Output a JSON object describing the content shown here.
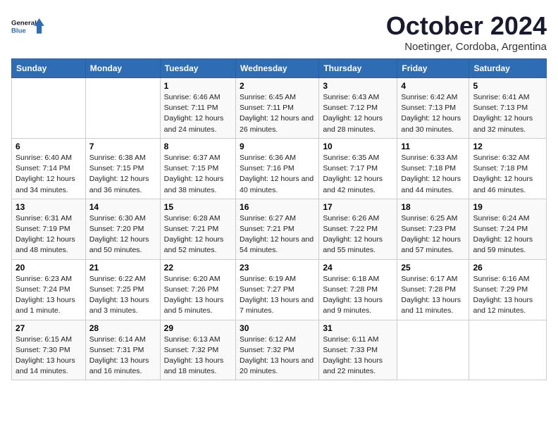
{
  "logo": {
    "line1": "General",
    "line2": "Blue"
  },
  "title": "October 2024",
  "subtitle": "Noetinger, Cordoba, Argentina",
  "days_header": [
    "Sunday",
    "Monday",
    "Tuesday",
    "Wednesday",
    "Thursday",
    "Friday",
    "Saturday"
  ],
  "weeks": [
    [
      {
        "num": "",
        "detail": ""
      },
      {
        "num": "",
        "detail": ""
      },
      {
        "num": "1",
        "detail": "Sunrise: 6:46 AM\nSunset: 7:11 PM\nDaylight: 12 hours and 24 minutes."
      },
      {
        "num": "2",
        "detail": "Sunrise: 6:45 AM\nSunset: 7:11 PM\nDaylight: 12 hours and 26 minutes."
      },
      {
        "num": "3",
        "detail": "Sunrise: 6:43 AM\nSunset: 7:12 PM\nDaylight: 12 hours and 28 minutes."
      },
      {
        "num": "4",
        "detail": "Sunrise: 6:42 AM\nSunset: 7:13 PM\nDaylight: 12 hours and 30 minutes."
      },
      {
        "num": "5",
        "detail": "Sunrise: 6:41 AM\nSunset: 7:13 PM\nDaylight: 12 hours and 32 minutes."
      }
    ],
    [
      {
        "num": "6",
        "detail": "Sunrise: 6:40 AM\nSunset: 7:14 PM\nDaylight: 12 hours and 34 minutes."
      },
      {
        "num": "7",
        "detail": "Sunrise: 6:38 AM\nSunset: 7:15 PM\nDaylight: 12 hours and 36 minutes."
      },
      {
        "num": "8",
        "detail": "Sunrise: 6:37 AM\nSunset: 7:15 PM\nDaylight: 12 hours and 38 minutes."
      },
      {
        "num": "9",
        "detail": "Sunrise: 6:36 AM\nSunset: 7:16 PM\nDaylight: 12 hours and 40 minutes."
      },
      {
        "num": "10",
        "detail": "Sunrise: 6:35 AM\nSunset: 7:17 PM\nDaylight: 12 hours and 42 minutes."
      },
      {
        "num": "11",
        "detail": "Sunrise: 6:33 AM\nSunset: 7:18 PM\nDaylight: 12 hours and 44 minutes."
      },
      {
        "num": "12",
        "detail": "Sunrise: 6:32 AM\nSunset: 7:18 PM\nDaylight: 12 hours and 46 minutes."
      }
    ],
    [
      {
        "num": "13",
        "detail": "Sunrise: 6:31 AM\nSunset: 7:19 PM\nDaylight: 12 hours and 48 minutes."
      },
      {
        "num": "14",
        "detail": "Sunrise: 6:30 AM\nSunset: 7:20 PM\nDaylight: 12 hours and 50 minutes."
      },
      {
        "num": "15",
        "detail": "Sunrise: 6:28 AM\nSunset: 7:21 PM\nDaylight: 12 hours and 52 minutes."
      },
      {
        "num": "16",
        "detail": "Sunrise: 6:27 AM\nSunset: 7:21 PM\nDaylight: 12 hours and 54 minutes."
      },
      {
        "num": "17",
        "detail": "Sunrise: 6:26 AM\nSunset: 7:22 PM\nDaylight: 12 hours and 55 minutes."
      },
      {
        "num": "18",
        "detail": "Sunrise: 6:25 AM\nSunset: 7:23 PM\nDaylight: 12 hours and 57 minutes."
      },
      {
        "num": "19",
        "detail": "Sunrise: 6:24 AM\nSunset: 7:24 PM\nDaylight: 12 hours and 59 minutes."
      }
    ],
    [
      {
        "num": "20",
        "detail": "Sunrise: 6:23 AM\nSunset: 7:24 PM\nDaylight: 13 hours and 1 minute."
      },
      {
        "num": "21",
        "detail": "Sunrise: 6:22 AM\nSunset: 7:25 PM\nDaylight: 13 hours and 3 minutes."
      },
      {
        "num": "22",
        "detail": "Sunrise: 6:20 AM\nSunset: 7:26 PM\nDaylight: 13 hours and 5 minutes."
      },
      {
        "num": "23",
        "detail": "Sunrise: 6:19 AM\nSunset: 7:27 PM\nDaylight: 13 hours and 7 minutes."
      },
      {
        "num": "24",
        "detail": "Sunrise: 6:18 AM\nSunset: 7:28 PM\nDaylight: 13 hours and 9 minutes."
      },
      {
        "num": "25",
        "detail": "Sunrise: 6:17 AM\nSunset: 7:28 PM\nDaylight: 13 hours and 11 minutes."
      },
      {
        "num": "26",
        "detail": "Sunrise: 6:16 AM\nSunset: 7:29 PM\nDaylight: 13 hours and 12 minutes."
      }
    ],
    [
      {
        "num": "27",
        "detail": "Sunrise: 6:15 AM\nSunset: 7:30 PM\nDaylight: 13 hours and 14 minutes."
      },
      {
        "num": "28",
        "detail": "Sunrise: 6:14 AM\nSunset: 7:31 PM\nDaylight: 13 hours and 16 minutes."
      },
      {
        "num": "29",
        "detail": "Sunrise: 6:13 AM\nSunset: 7:32 PM\nDaylight: 13 hours and 18 minutes."
      },
      {
        "num": "30",
        "detail": "Sunrise: 6:12 AM\nSunset: 7:32 PM\nDaylight: 13 hours and 20 minutes."
      },
      {
        "num": "31",
        "detail": "Sunrise: 6:11 AM\nSunset: 7:33 PM\nDaylight: 13 hours and 22 minutes."
      },
      {
        "num": "",
        "detail": ""
      },
      {
        "num": "",
        "detail": ""
      }
    ]
  ]
}
